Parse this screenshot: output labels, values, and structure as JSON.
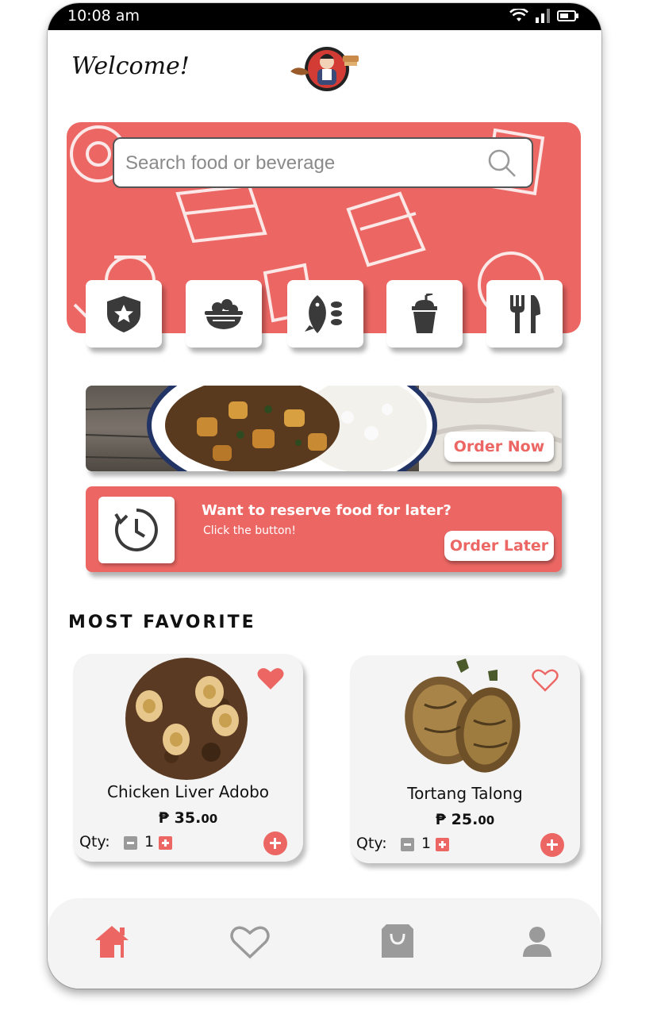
{
  "status_bar": {
    "time": "10:08 am"
  },
  "header": {
    "welcome": "Welcome!"
  },
  "search": {
    "placeholder": "Search food or beverage"
  },
  "categories": [
    {
      "icon": "star-badge-icon"
    },
    {
      "icon": "salad-bowl-icon"
    },
    {
      "icon": "fish-icon"
    },
    {
      "icon": "drink-cup-icon"
    },
    {
      "icon": "fork-knife-icon"
    }
  ],
  "promo": {
    "button_label": "Order Now"
  },
  "reserve": {
    "title": "Want to reserve food for later?",
    "subtitle": "Click the button!",
    "button_label": "Order Later"
  },
  "favorites": {
    "title": "MOST FAVORITE",
    "qty_label": "Qty:",
    "items": [
      {
        "name": "Chicken Liver Adobo",
        "currency": "₱",
        "price_main": "35.",
        "price_cents": "00",
        "qty": "1",
        "favorited": true
      },
      {
        "name": "Tortang Talong",
        "currency": "₱",
        "price_main": "25.",
        "price_cents": "00",
        "qty": "1",
        "favorited": false
      }
    ]
  },
  "nav": {
    "items": [
      {
        "icon": "home-icon",
        "active": true
      },
      {
        "icon": "heart-icon",
        "active": false
      },
      {
        "icon": "shopping-bag-icon",
        "active": false
      },
      {
        "icon": "user-icon",
        "active": false
      }
    ]
  },
  "colors": {
    "accent": "#ec6764",
    "icon_dark": "#3a3a3a",
    "icon_gray": "#9a9a9a"
  }
}
